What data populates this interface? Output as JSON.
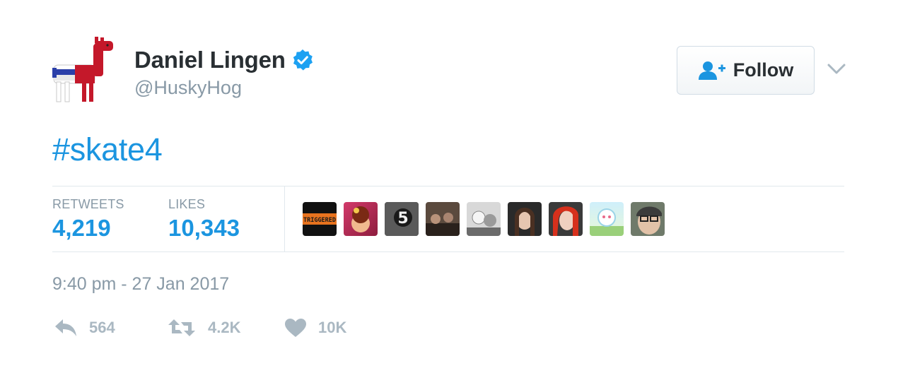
{
  "author": {
    "name": "Daniel Lingen",
    "handle": "@HuskyHog",
    "verified": true,
    "avatar_icon": "llama-avatar-icon"
  },
  "follow": {
    "label": "Follow",
    "icon": "person-add-icon"
  },
  "menu": {
    "icon": "chevron-down-icon"
  },
  "tweet": {
    "text": "#skate4"
  },
  "stats": {
    "retweets_label": "RETWEETS",
    "retweets_value": "4,219",
    "likes_label": "LIKES",
    "likes_value": "10,343"
  },
  "likers": [
    {
      "name": "liker-avatar-1",
      "caption": "TRIGGERED"
    },
    {
      "name": "liker-avatar-2"
    },
    {
      "name": "liker-avatar-3",
      "caption": "5"
    },
    {
      "name": "liker-avatar-4"
    },
    {
      "name": "liker-avatar-5"
    },
    {
      "name": "liker-avatar-6"
    },
    {
      "name": "liker-avatar-7"
    },
    {
      "name": "liker-avatar-8"
    },
    {
      "name": "liker-avatar-9"
    }
  ],
  "timestamp": "9:40 pm - 27 Jan 2017",
  "actions": {
    "reply_count": "564",
    "retweet_count": "4.2K",
    "like_count": "10K"
  },
  "colors": {
    "link": "#1b95e0",
    "muted": "#8899a6",
    "action_gray": "#aab8c2",
    "verified": "#1da1f2"
  }
}
